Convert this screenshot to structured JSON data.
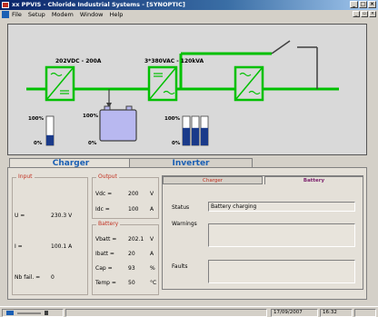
{
  "window": {
    "title": "xx PPVIS - Chloride Industrial Systems - [SYNOPTIC]"
  },
  "menu": {
    "items": [
      "File",
      "Setup",
      "Modem",
      "Window",
      "Help"
    ]
  },
  "synoptic": {
    "labels": {
      "dc": "202VDC - 200A",
      "ac": "3*380VAC - 120kVA"
    },
    "battery_gauge": {
      "top": "100%",
      "bottom": "0%",
      "level": 0.35
    },
    "battery_block": {
      "top": "100%",
      "bottom": "0%"
    },
    "load_gauge": {
      "top": "100%",
      "bottom": "0%",
      "levels": [
        0.6,
        0.6,
        0.6
      ]
    },
    "colors": {
      "line": "#00c000",
      "module": "#00c000",
      "battery": "#b8b8f0",
      "gauge_fill": "#1a3a8a"
    }
  },
  "tabs": {
    "charger": "Charger",
    "inverter": "Inverter"
  },
  "input": {
    "title": "Input",
    "u_label": "U =",
    "u_value": "230.3 V",
    "i_label": "I =",
    "i_value": "100.1 A",
    "fail_label": "Nb fail. =",
    "fail_value": "0"
  },
  "output": {
    "title": "Output",
    "vdc_label": "Vdc =",
    "vdc_value": "200",
    "vdc_unit": "V",
    "idc_label": "Idc =",
    "idc_value": "100",
    "idc_unit": "A"
  },
  "battery": {
    "title": "Battery",
    "vbatt_label": "Vbatt =",
    "vbatt_value": "202.1",
    "vbatt_unit": "V",
    "ibatt_label": "Ibatt =",
    "ibatt_value": "20",
    "ibatt_unit": "A",
    "cap_label": "Cap =",
    "cap_value": "93",
    "cap_unit": "%",
    "temp_label": "Temp =",
    "temp_value": "50",
    "temp_unit": "°C"
  },
  "status_panel": {
    "tab_charger": "Charger",
    "tab_battery": "Battery",
    "status_label": "Status",
    "status_value": "Battery charging",
    "warnings_label": "Warnings",
    "warnings_value": "",
    "faults_label": "Faults",
    "faults_value": ""
  },
  "statusbar": {
    "date": "17/09/2007",
    "time": "16:32"
  }
}
